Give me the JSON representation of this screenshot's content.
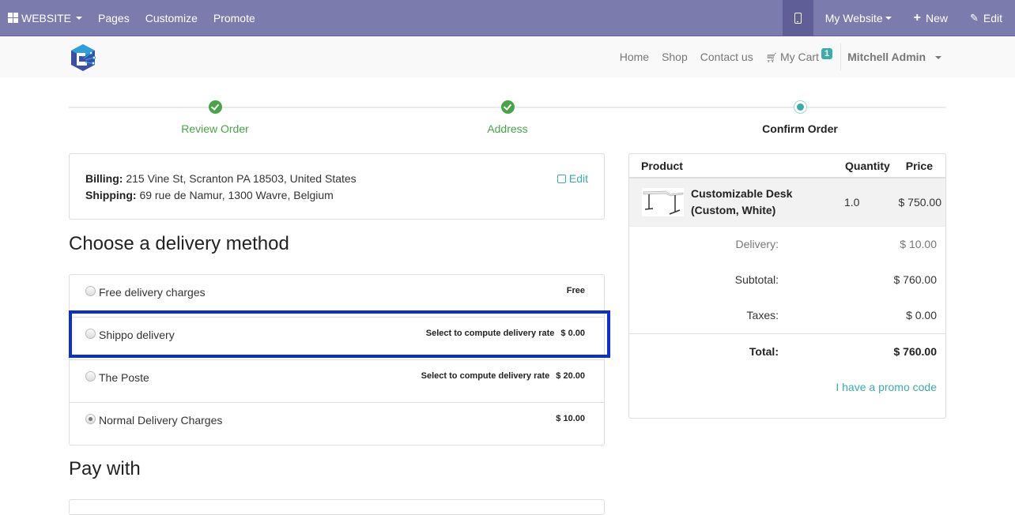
{
  "adminbar": {
    "app_menu_label": "WEBSITE",
    "menu": [
      "Pages",
      "Customize",
      "Promote"
    ],
    "mobile_preview_icon": "mobile-phone-icon",
    "website_selector": "My Website",
    "new_label": "New",
    "edit_label": "Edit",
    "color": "#7c7bad"
  },
  "sitenav": {
    "links": [
      "Home",
      "Shop",
      "Contact us"
    ],
    "cart_label": "My Cart",
    "cart_count": "1",
    "user_name": "Mitchell Admin"
  },
  "wizard": {
    "steps": [
      {
        "label": "Review Order",
        "state": "done"
      },
      {
        "label": "Address",
        "state": "done"
      },
      {
        "label": "Confirm Order",
        "state": "current"
      }
    ]
  },
  "address": {
    "billing_label": "Billing:",
    "billing_value": "215 Vine St, Scranton PA 18503, United States",
    "shipping_label": "Shipping:",
    "shipping_value": "69 rue de Namur, 1300 Wavre, Belgium",
    "edit_label": "Edit"
  },
  "delivery": {
    "title": "Choose a delivery method",
    "methods": [
      {
        "name": "Free delivery charges",
        "hint": "",
        "price": "Free",
        "selected": false
      },
      {
        "name": "Shippo delivery",
        "hint": "Select to compute delivery rate",
        "price": "$ 0.00",
        "selected": false,
        "highlighted": true
      },
      {
        "name": "The Poste",
        "hint": "Select to compute delivery rate",
        "price": "$ 20.00",
        "selected": false
      },
      {
        "name": "Normal Delivery Charges",
        "hint": "",
        "price": "$ 10.00",
        "selected": true
      }
    ]
  },
  "payment": {
    "title": "Pay with"
  },
  "summary": {
    "headers": {
      "product": "Product",
      "quantity": "Quantity",
      "price": "Price"
    },
    "lines": [
      {
        "name_line1": "Customizable Desk",
        "name_line2": "(Custom, White)",
        "quantity": "1.0",
        "price": "$ 750.00"
      }
    ],
    "delivery_label": "Delivery:",
    "delivery_value": "$ 10.00",
    "subtotal_label": "Subtotal:",
    "subtotal_value": "$ 760.00",
    "taxes_label": "Taxes:",
    "taxes_value": "$ 0.00",
    "total_label": "Total:",
    "total_value": "$ 760.00",
    "promo_label": "I have a promo code"
  },
  "colors": {
    "accent": "#3aadaa",
    "success": "#47a447",
    "highlight_border": "#0a2fd9"
  }
}
